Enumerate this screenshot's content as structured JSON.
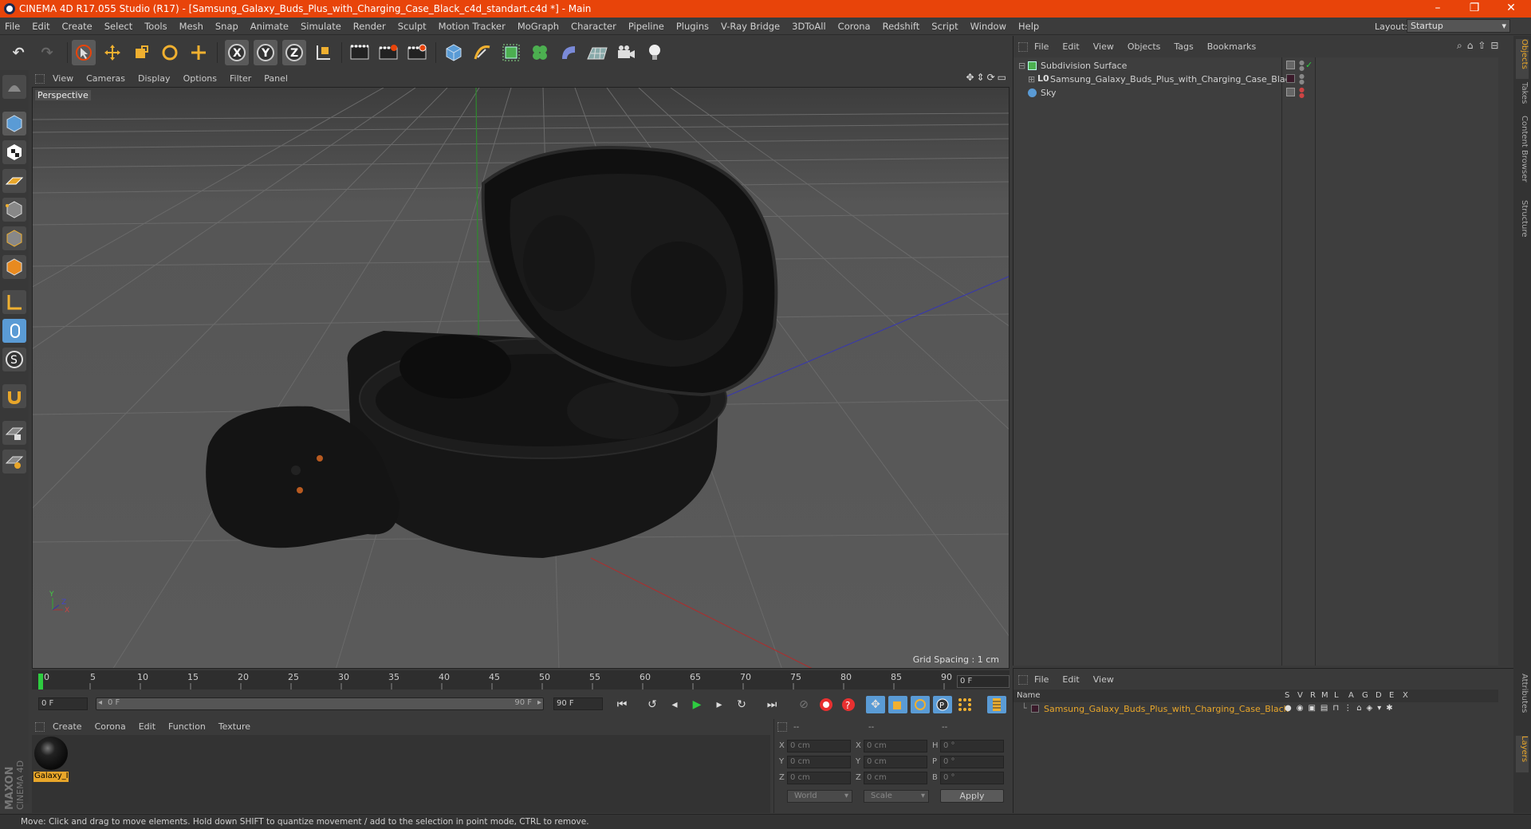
{
  "window": {
    "title": "CINEMA 4D R17.055 Studio (R17) - [Samsung_Galaxy_Buds_Plus_with_Charging_Case_Black_c4d_standart.c4d *] - Main",
    "minimize": "–",
    "maximize": "❐",
    "close": "✕"
  },
  "menubar": {
    "items": [
      "File",
      "Edit",
      "Create",
      "Select",
      "Tools",
      "Mesh",
      "Snap",
      "Animate",
      "Simulate",
      "Render",
      "Sculpt",
      "Motion Tracker",
      "MoGraph",
      "Character",
      "Pipeline",
      "Plugins",
      "V-Ray Bridge",
      "3DToAll",
      "Corona",
      "Redshift",
      "Script",
      "Window",
      "Help"
    ],
    "layout_label": "Layout:",
    "layout_value": "Startup"
  },
  "viewport": {
    "menu": [
      "View",
      "Cameras",
      "Display",
      "Options",
      "Filter",
      "Panel"
    ],
    "label": "Perspective",
    "grid_spacing": "Grid Spacing : 1 cm",
    "axis_y": "Y",
    "axis_x": "X",
    "axis_z": "Z"
  },
  "timeline": {
    "ticks": [
      "0",
      "5",
      "10",
      "15",
      "20",
      "25",
      "30",
      "35",
      "40",
      "45",
      "50",
      "55",
      "60",
      "65",
      "70",
      "75",
      "80",
      "85",
      "90"
    ],
    "current_frame": "0 F",
    "start_field": "0 F",
    "range_start": "0 F",
    "range_end": "90 F",
    "end_field": "90 F"
  },
  "material_manager": {
    "menu": [
      "Create",
      "Corona",
      "Edit",
      "Function",
      "Texture"
    ],
    "material_name": "Galaxy_I"
  },
  "coordinates": {
    "headers": [
      "--",
      "--",
      "--"
    ],
    "rows": [
      {
        "label1": "X",
        "val1": "0 cm",
        "label2": "X",
        "val2": "0 cm",
        "label3": "H",
        "val3": "0 °"
      },
      {
        "label1": "Y",
        "val1": "0 cm",
        "label2": "Y",
        "val2": "0 cm",
        "label3": "P",
        "val3": "0 °"
      },
      {
        "label1": "Z",
        "val1": "0 cm",
        "label2": "Z",
        "val2": "0 cm",
        "label3": "B",
        "val3": "0 °"
      }
    ],
    "mode1": "World",
    "mode2": "Scale",
    "apply": "Apply"
  },
  "object_manager": {
    "menu": [
      "File",
      "Edit",
      "View",
      "Objects",
      "Tags",
      "Bookmarks"
    ],
    "objects": [
      {
        "name": "Subdivision Surface"
      },
      {
        "name": "Samsung_Galaxy_Buds_Plus_with_Charging_Case_Black"
      },
      {
        "name": "Sky"
      }
    ]
  },
  "layer_manager": {
    "menu": [
      "File",
      "Edit",
      "View"
    ],
    "columns": [
      "Name",
      "S",
      "V",
      "R",
      "M",
      "L",
      "A",
      "G",
      "D",
      "E",
      "X"
    ],
    "layer_name": "Samsung_Galaxy_Buds_Plus_with_Charging_Case_Black"
  },
  "side_tabs": [
    "Objects",
    "Takes",
    "Content Browser",
    "Structure",
    "Attributes",
    "Layers"
  ],
  "statusbar": {
    "text": "Move: Click and drag to move elements. Hold down SHIFT to quantize movement / add to the selection in point mode, CTRL to remove."
  },
  "colors": {
    "accent": "#e8440a",
    "highlight": "#e8a62a",
    "selection_blue": "#5a9bd5"
  }
}
